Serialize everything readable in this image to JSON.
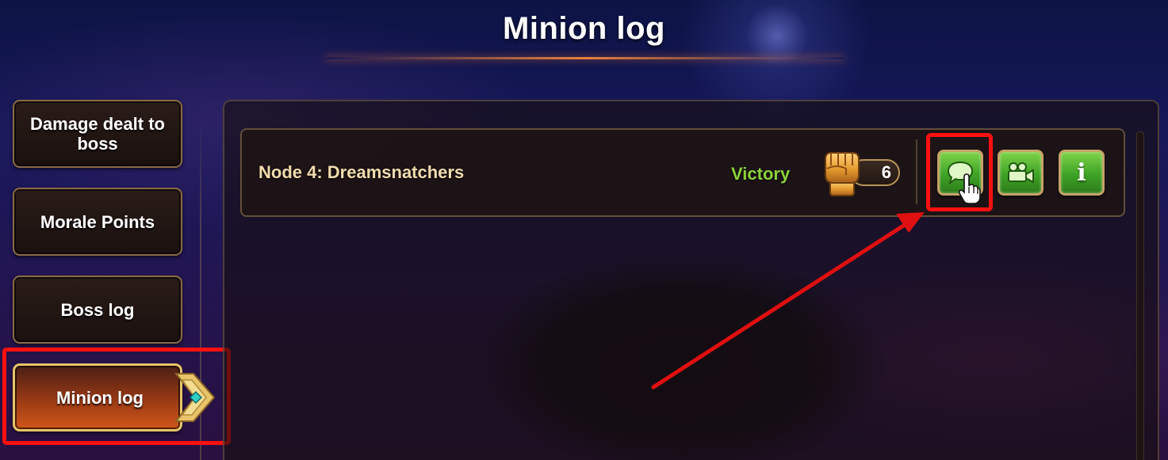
{
  "header": {
    "title": "Minion log"
  },
  "sidebar": {
    "items": [
      {
        "label": "Damage dealt to boss",
        "active": false
      },
      {
        "label": "Morale Points",
        "active": false
      },
      {
        "label": "Boss log",
        "active": false
      },
      {
        "label": "Minion log",
        "active": true
      }
    ]
  },
  "log": {
    "entries": [
      {
        "node": "Node 4: Dreamsnatchers",
        "result": "Victory",
        "score": "6",
        "score_icon": "fist-icon",
        "actions": [
          {
            "icon": "chat-bubble-icon",
            "highlighted": true
          },
          {
            "icon": "video-camera-icon",
            "highlighted": false
          },
          {
            "icon": "info-icon",
            "glyph": "i",
            "highlighted": false
          }
        ]
      }
    ]
  },
  "annotations": {
    "highlight_color": "#ff1010",
    "arrow_color": "#e01010"
  },
  "colors": {
    "victory": "#8bd23a",
    "node_text": "#f1dcae",
    "gold_border": "#c6a366",
    "active_tab_gradient_end": "#d2561a"
  }
}
